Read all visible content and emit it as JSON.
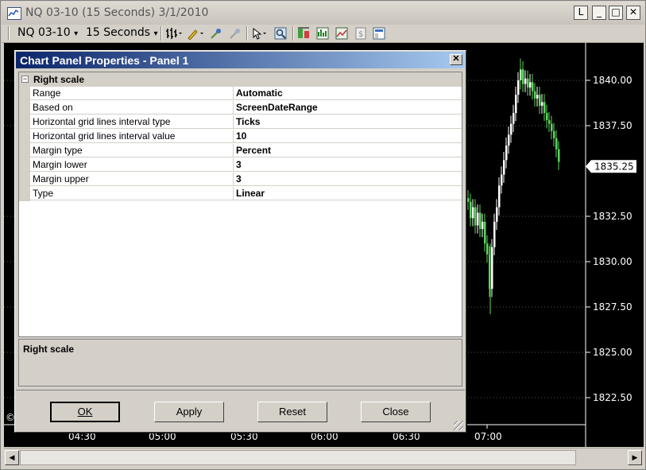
{
  "window": {
    "title": "NQ 03-10 (15 Seconds)  3/1/2010",
    "buttons": {
      "l": "L",
      "minimize": "_",
      "maximize": "□",
      "close": "✕"
    }
  },
  "toolbar": {
    "instrument": "NQ 03-10",
    "interval": "15 Seconds",
    "dropdown_arrow": "▾"
  },
  "chart": {
    "price_labels": [
      "1840.00",
      "1837.50",
      "1835.25",
      "1832.50",
      "1830.00",
      "1827.50",
      "1825.00",
      "1822.50"
    ],
    "current_price": "1835.25",
    "time_labels": [
      "04:30",
      "05:00",
      "05:30",
      "06:00",
      "06:30",
      "07:00"
    ],
    "copyright": "©",
    "colors": {
      "background": "#000000",
      "up": "#ffffff",
      "down": "#5cd65c",
      "grid": "#555555"
    }
  },
  "dialog": {
    "title": "Chart Panel Properties - Panel 1",
    "close": "✕",
    "category": {
      "toggle": "⊟",
      "label": "Right scale"
    },
    "properties": [
      {
        "name": "Range",
        "value": "Automatic"
      },
      {
        "name": "Based on",
        "value": "ScreenDateRange"
      },
      {
        "name": "Horizontal grid lines interval type",
        "value": "Ticks"
      },
      {
        "name": "Horizontal grid lines interval value",
        "value": "10"
      },
      {
        "name": "Margin type",
        "value": "Percent"
      },
      {
        "name": "Margin lower",
        "value": "3"
      },
      {
        "name": "Margin upper",
        "value": "3"
      },
      {
        "name": "Type",
        "value": "Linear"
      }
    ],
    "description_title": "Right scale",
    "buttons": {
      "ok": "OK",
      "apply": "Apply",
      "reset": "Reset",
      "close": "Close"
    }
  },
  "scrollbar": {
    "left_arrow": "◀",
    "right_arrow": "▶"
  }
}
